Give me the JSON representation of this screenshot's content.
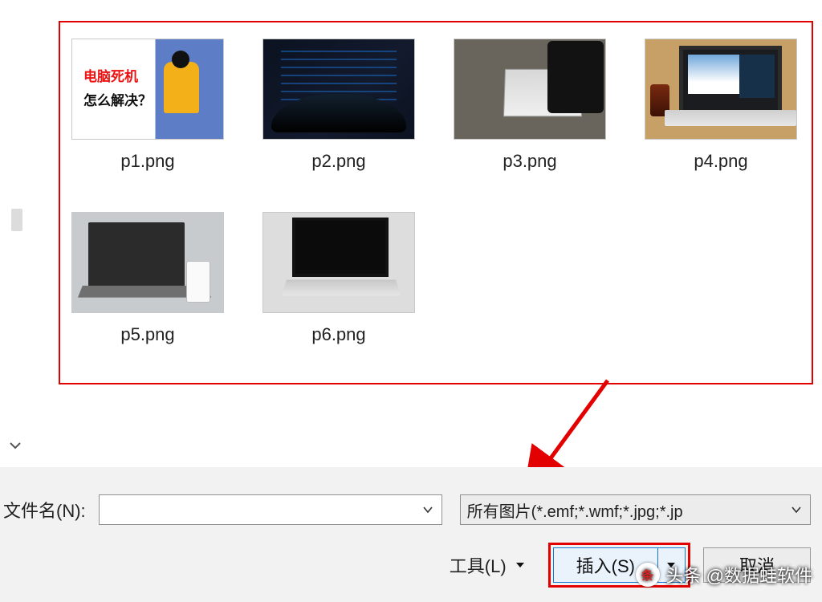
{
  "thumbs": [
    {
      "label": "p1.png",
      "preview_text1": "电脑死机",
      "preview_text2": "怎么解决？"
    },
    {
      "label": "p2.png"
    },
    {
      "label": "p3.png"
    },
    {
      "label": "p4.png"
    },
    {
      "label": "p5.png"
    },
    {
      "label": "p6.png"
    }
  ],
  "filename": {
    "label": "文件名(N):",
    "value": ""
  },
  "filter": {
    "selected": "所有图片(*.emf;*.wmf;*.jpg;*.jp"
  },
  "tools_label": "工具(L)",
  "insert_label": "插入(S)",
  "cancel_label": "取消",
  "watermark": "头条 @数据蛙软件",
  "watermark_badge": "头条"
}
